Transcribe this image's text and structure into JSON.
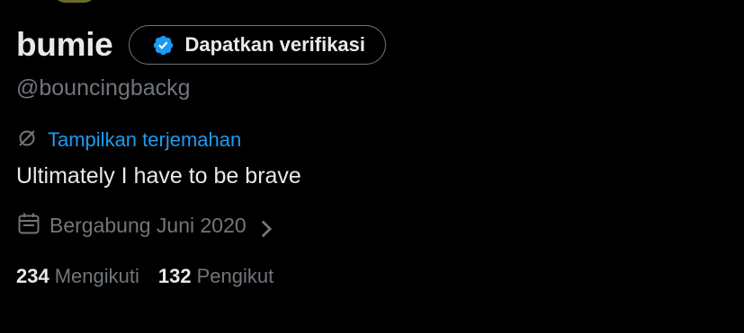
{
  "profile": {
    "display_name": "bumie",
    "handle": "@bouncingbackg",
    "bio": "Ultimately I have to be brave"
  },
  "verify_button": {
    "label": "Dapatkan verifikasi",
    "icon": "verified-badge-icon",
    "badge_color": "#1d9bf0"
  },
  "translate": {
    "label": "Tampilkan terjemahan",
    "icon": "translate-icon",
    "color": "#1d9bf0"
  },
  "joined": {
    "label": "Bergabung Juni 2020",
    "icon": "calendar-icon"
  },
  "stats": {
    "following_count": "234",
    "following_label": "Mengikuti",
    "followers_count": "132",
    "followers_label": "Pengikut"
  },
  "colors": {
    "background": "#000000",
    "primary_text": "#e7e9ea",
    "secondary_text": "#71767b",
    "accent": "#1d9bf0"
  }
}
